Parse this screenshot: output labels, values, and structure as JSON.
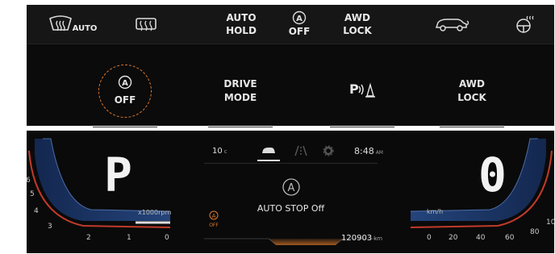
{
  "top_bar": {
    "defrost_auto_label": "AUTO",
    "auto_hold_line1": "AUTO",
    "auto_hold_line2": "HOLD",
    "auto_off_label": "OFF",
    "awd_lock_line1": "AWD",
    "awd_lock_line2": "LOCK"
  },
  "buttons": {
    "auto_stop_off_label": "OFF",
    "drive_mode_line1": "DRIVE",
    "drive_mode_line2": "MODE",
    "awd_lock_line1": "AWD",
    "awd_lock_line2": "LOCK"
  },
  "cluster": {
    "gear": "P",
    "speed": "0",
    "tach_unit": "x1000rpm",
    "tach_ticks": [
      "6",
      "5",
      "4",
      "3",
      "2",
      "1",
      "0"
    ],
    "speed_unit": "km/h",
    "speed_ticks": [
      "0",
      "20",
      "40",
      "60",
      "80",
      "10"
    ],
    "temperature": "10",
    "temperature_unit": "c",
    "time": "8:48",
    "time_period": "AM",
    "message": "AUTO STOP Off",
    "odometer": "120903",
    "odometer_unit": "km",
    "auto_stop_indicator": "OFF"
  },
  "colors": {
    "accent_orange": "#e07a2c",
    "gauge_blue": "#2a63c9",
    "background": "#0b0b0c"
  }
}
